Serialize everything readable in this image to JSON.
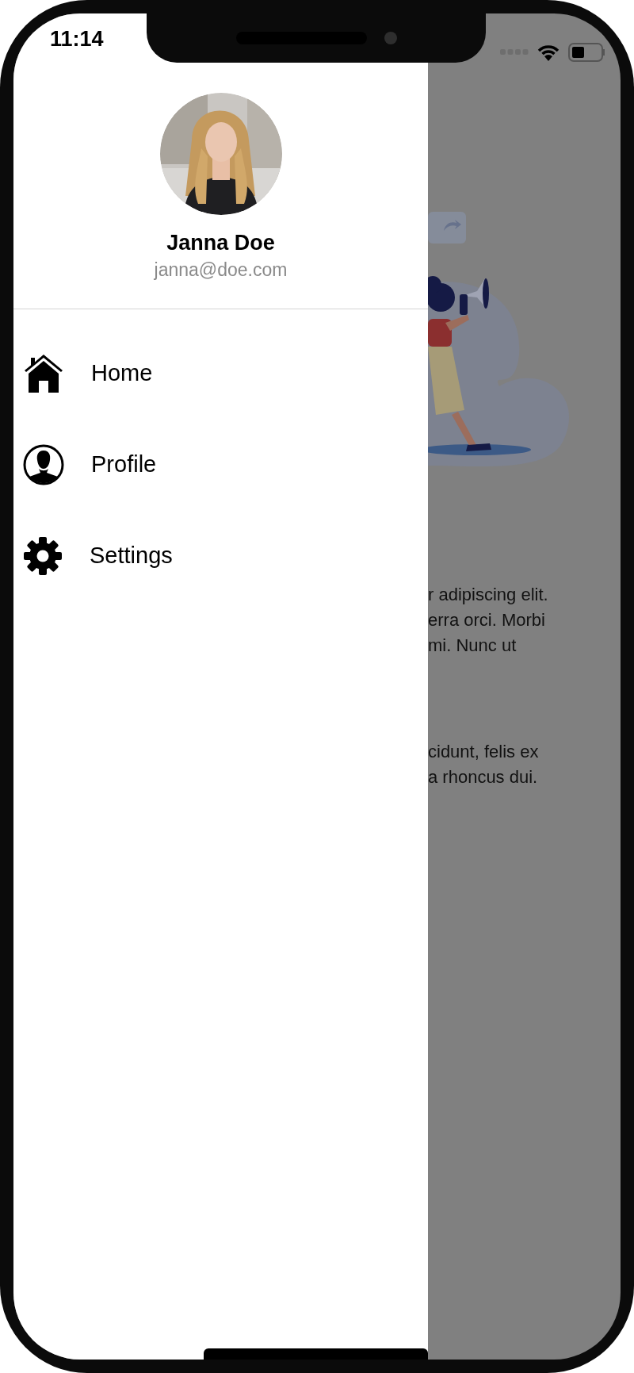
{
  "status_bar": {
    "time": "11:14"
  },
  "drawer": {
    "profile": {
      "name": "Janna Doe",
      "email": "janna@doe.com"
    },
    "menu": [
      {
        "label": "Home",
        "kind": "home"
      },
      {
        "label": "Profile",
        "kind": "profile"
      },
      {
        "label": "Settings",
        "kind": "settings"
      }
    ]
  },
  "background": {
    "paragraphs": [
      [
        "r adipiscing elit.",
        "erra orci. Morbi",
        "mi. Nunc ut"
      ],
      [
        "cidunt, felis ex",
        "a rhoncus dui."
      ]
    ]
  }
}
